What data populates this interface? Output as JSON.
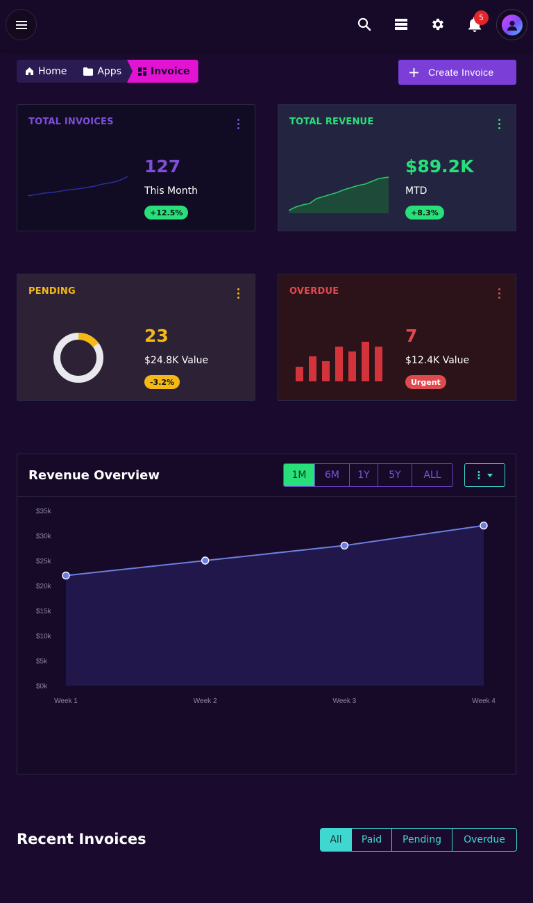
{
  "topbar": {
    "notifications_count": "5",
    "icons": [
      "menu-icon",
      "search-icon",
      "layers-icon",
      "gear-icon",
      "bell-icon",
      "user-icon"
    ]
  },
  "breadcrumb": [
    {
      "label": "Home",
      "icon": "home-icon"
    },
    {
      "label": "Apps",
      "icon": "folder-icon"
    },
    {
      "label": "Invoice",
      "icon": "dashboard-icon"
    }
  ],
  "create_button": {
    "label": "Create Invoice",
    "icon": "plus-icon"
  },
  "cards": {
    "total_invoices": {
      "title": "TOTAL INVOICES",
      "value": "127",
      "sub": "This Month",
      "badge": "+12.5%",
      "color": "#7d4fd9",
      "badge_color": "#27e07a",
      "bg": "#120b24"
    },
    "total_revenue": {
      "title": "TOTAL REVENUE",
      "value": "$89.2K",
      "sub": "MTD",
      "badge": "+8.3%",
      "color": "#27e07a",
      "badge_color": "#27e07a",
      "bg": "#232540"
    },
    "pending": {
      "title": "PENDING",
      "value": "23",
      "sub": "$24.8K Value",
      "badge": "-3.2%",
      "color": "#f5b915",
      "badge_color": "#f5b915",
      "bg": "#2d2235",
      "donut_fraction": 0.15
    },
    "overdue": {
      "title": "OVERDUE",
      "value": "7",
      "sub": "$12.4K Value",
      "badge": "Urgent",
      "color": "#e04a4f",
      "badge_color": "#e04a4f",
      "bg": "#2b1319"
    }
  },
  "revenue_overview": {
    "title": "Revenue Overview",
    "ranges": [
      "1M",
      "6M",
      "1Y",
      "5Y",
      "ALL"
    ],
    "active_range": "1M"
  },
  "chart_data": {
    "type": "area",
    "categories": [
      "Week 1",
      "Week 2",
      "Week 3",
      "Week 4"
    ],
    "series": [
      {
        "values": [
          22000,
          25000,
          28000,
          32000
        ]
      }
    ],
    "y_ticks": [
      "$0k",
      "$5k",
      "$10k",
      "$15k",
      "$20k",
      "$25k",
      "$30k",
      "$35k"
    ],
    "ylim": [
      0,
      35000
    ],
    "grid": false,
    "line_color": "#6b7fe0"
  },
  "recent_invoices": {
    "title": "Recent Invoices",
    "filters": [
      "All",
      "Paid",
      "Pending",
      "Overdue"
    ],
    "active_filter": "All"
  }
}
